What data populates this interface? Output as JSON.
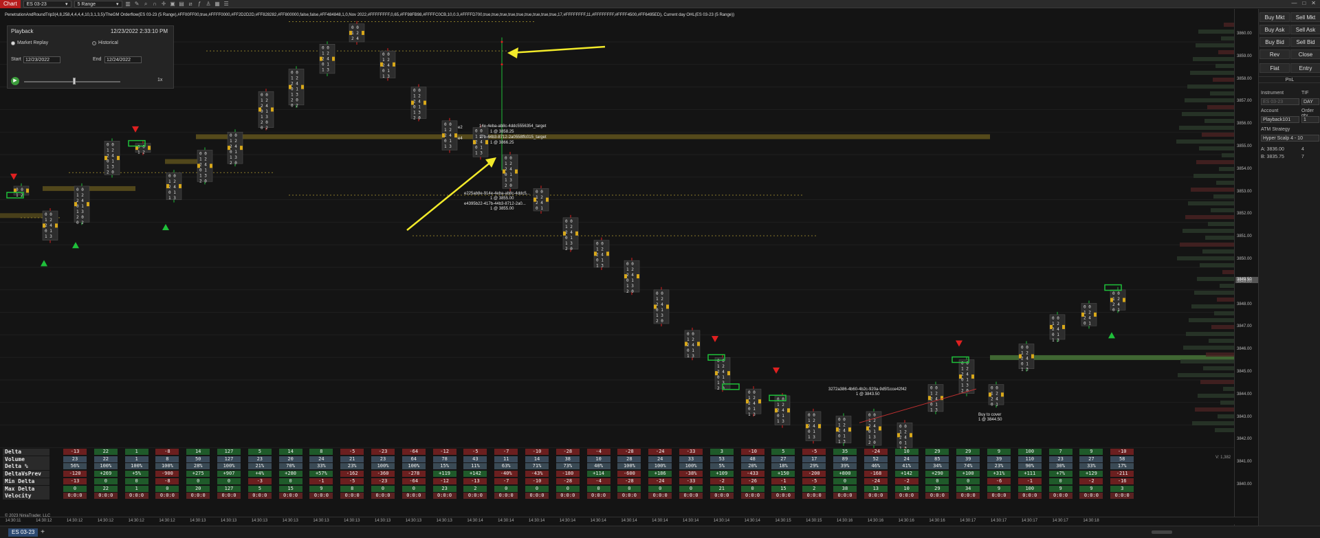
{
  "toolbar": {
    "chart_tag": "Chart",
    "instrument": "ES 03-23",
    "bar_type": "5 Range"
  },
  "indicator_label": "PenetrationAndRoundTrip3(4,8,258,4,4,4,4,10,3,1,3,5)/TheGM Orderflow(ES 03-23 (5 Range),#FF00FF00,true,#FFFF0000,#FF2D2D2D,#FF828282,#FF800000,false,false,#FF484848,1,0,Nov 2022,#FFFFFFFF,0,65,#FF98FB98,#FFFFC0CB,10,0.3,#FFFFD700,true,true,true,true,true,true,true,true,true,17,#FFFFFFFF,11,#FFFFFFFF,#FFFF4500,#FF6495ED), Current day OHL(ES 03-23 (5 Range))",
  "playback": {
    "title": "Playback",
    "datetime": "12/23/2022 2:33:10 PM",
    "market_replay": "Market Replay",
    "historical": "Historical",
    "start_label": "Start",
    "start_value": "12/23/2022",
    "end_label": "End",
    "end_value": "12/24/2022",
    "speed": "1x"
  },
  "price_axis": {
    "labels": [
      "3860.00",
      "3859.00",
      "3858.00",
      "3857.00",
      "3856.00",
      "3855.00",
      "3854.00",
      "3853.00",
      "3852.00",
      "3851.00",
      "3850.00",
      "3849.00",
      "3848.00",
      "3847.00",
      "3846.00",
      "3845.00",
      "3844.00",
      "3843.00",
      "3842.00",
      "3841.00",
      "3840.00"
    ],
    "current": "3849.50"
  },
  "annotations": {
    "target1": "14e-4eba-ab8c-4ddc5556354_target",
    "target1_price": "1 @ 3858.25",
    "target2": "17b-44b3-8712-2a0558ffc015_target",
    "target2_price": "1 @ 3866.25",
    "stop1": "e225ab8e-914e-4eba-ab8c-4ddc5...",
    "stop1_price": "1 @ 3855.00",
    "stop2": "e4395b22-417b-44b3-8712-2a0...",
    "stop2_price": "1 @ 3855.00",
    "order3": "3272a386-4b60-4b2c-920a-9d5f1cce42f42",
    "order3_price": "1 @ 3843.50",
    "buy_cover": "Buy to cover",
    "buy_cover_price": "1 @ 3844.50",
    "small_a": "e2",
    "small_b": "e4"
  },
  "stats": {
    "row_names": [
      "Delta",
      "Volume",
      "Delta %",
      "DeltaVsPrev",
      "Min Delta",
      "Max Delta",
      "Velocity"
    ],
    "columns": [
      [
        "-13",
        "23",
        "56%",
        "-120",
        "-13",
        "0",
        "0:0:0"
      ],
      [
        "22",
        "22",
        "100%",
        "+269",
        "0",
        "22",
        "0:0:0"
      ],
      [
        "1",
        "1",
        "100%",
        "+5%",
        "0",
        "1",
        "0:0:0"
      ],
      [
        "-8",
        "8",
        "100%",
        "-900",
        "-8",
        "0",
        "0:0:0"
      ],
      [
        "14",
        "50",
        "28%",
        "+275",
        "0",
        "20",
        "0:0:0"
      ],
      [
        "127",
        "127",
        "100%",
        "+907",
        "0",
        "127",
        "0:0:0"
      ],
      [
        "5",
        "23",
        "21%",
        "+4%",
        "-3",
        "5",
        "0:0:0"
      ],
      [
        "14",
        "20",
        "70%",
        "+280",
        "0",
        "15",
        "0:0:0"
      ],
      [
        "8",
        "24",
        "33%",
        "+57%",
        "-1",
        "9",
        "0:0:0"
      ],
      [
        "-5",
        "21",
        "23%",
        "-162",
        "-5",
        "8",
        "0:0:0"
      ],
      [
        "-23",
        "23",
        "100%",
        "-360",
        "-23",
        "0",
        "0:0:0"
      ],
      [
        "-64",
        "64",
        "100%",
        "-278",
        "-64",
        "0",
        "0:0:0"
      ],
      [
        "-12",
        "78",
        "15%",
        "+119",
        "-12",
        "23",
        "0:0:0"
      ],
      [
        "-5",
        "43",
        "11%",
        "+142",
        "-13",
        "2",
        "0:0:0"
      ],
      [
        "-7",
        "11",
        "63%",
        "-40%",
        "-7",
        "0",
        "0:0:0"
      ],
      [
        "-10",
        "14",
        "71%",
        "-43%",
        "-10",
        "0",
        "0:0:0"
      ],
      [
        "-28",
        "38",
        "73%",
        "-180",
        "-28",
        "0",
        "0:0:0"
      ],
      [
        "-4",
        "10",
        "40%",
        "+114",
        "-4",
        "0",
        "0:0:0"
      ],
      [
        "-28",
        "28",
        "100%",
        "-600",
        "-28",
        "0",
        "0:0:0"
      ],
      [
        "-24",
        "24",
        "100%",
        "+186",
        "-24",
        "0",
        "0:0:0"
      ],
      [
        "-33",
        "33",
        "100%",
        "-38%",
        "-33",
        "0",
        "0:0:0"
      ],
      [
        "3",
        "53",
        "5%",
        "+109",
        "-2",
        "21",
        "0:0:0"
      ],
      [
        "-10",
        "48",
        "20%",
        "-433",
        "-26",
        "0",
        "0:0:0"
      ],
      [
        "5",
        "27",
        "18%",
        "+150",
        "-1",
        "15",
        "0:0:0"
      ],
      [
        "-5",
        "17",
        "29%",
        "-200",
        "-5",
        "2",
        "0:0:0"
      ],
      [
        "35",
        "89",
        "39%",
        "+800",
        "0",
        "38",
        "0:0:0"
      ],
      [
        "-24",
        "52",
        "46%",
        "-168",
        "-24",
        "13",
        "0:0:0"
      ],
      [
        "10",
        "24",
        "41%",
        "+142",
        "-2",
        "10",
        "0:0:0"
      ],
      [
        "29",
        "85",
        "34%",
        "+290",
        "0",
        "29",
        "0:0:0"
      ],
      [
        "29",
        "39",
        "74%",
        "+100",
        "0",
        "34",
        "0:0:0"
      ],
      [
        "9",
        "39",
        "23%",
        "+31%",
        "-6",
        "9",
        "0:0:0"
      ],
      [
        "100",
        "110",
        "90%",
        "+111",
        "-1",
        "100",
        "0:0:0"
      ],
      [
        "7",
        "23",
        "30%",
        "+7%",
        "0",
        "9",
        "0:0:0"
      ],
      [
        "9",
        "27",
        "33%",
        "+129",
        "-2",
        "9",
        "0:0:0"
      ],
      [
        "-10",
        "58",
        "17%",
        "-211",
        "-16",
        "3",
        "0:0:0"
      ]
    ]
  },
  "time_axis": [
    "14:30:11",
    "14:30:12",
    "14:30:12",
    "14:30:12",
    "14:30:12",
    "14:30:12",
    "14:30:13",
    "14:30:13",
    "14:30:13",
    "14:30:13",
    "14:30:13",
    "14:30:13",
    "14:30:13",
    "14:30:13",
    "14:30:13",
    "14:30:14",
    "14:30:14",
    "14:30:14",
    "14:30:14",
    "14:30:14",
    "14:30:14",
    "14:30:14",
    "14:30:14",
    "14:30:14",
    "14:30:14",
    "14:30:15",
    "14:30:15",
    "14:30:16",
    "14:30:16",
    "14:30:16",
    "14:30:16",
    "14:30:17",
    "14:30:17",
    "14:30:17",
    "14:30:17",
    "14:30:18"
  ],
  "copyright": "© 2023 NinjaTrader, LLC",
  "bottom": {
    "tab": "ES 03-23",
    "add": "+"
  },
  "trader": {
    "buy_mkt": "Buy Mkt",
    "sell_mkt": "Sell Mkt",
    "buy_ask": "Buy Ask",
    "sell_ask": "Sell Ask",
    "buy_bid": "Buy Bid",
    "sell_bid": "Sell Bid",
    "rev": "Rev",
    "close": "Close",
    "flat": "Flat",
    "entry": "Entry",
    "pnl": "PnL",
    "instrument_label": "Instrument",
    "tif_label": "TIF",
    "instrument_value": "ES 03-23",
    "tif_value": "DAY",
    "account_label": "Account",
    "order_qty_label": "Order qty",
    "account_value": "Playback101",
    "qty_value": "1",
    "atm_label": "ATM Strategy",
    "atm_value": "Hyper Scalp 4 - 10",
    "ask_label": "A: 3836.00",
    "ask_size": "4",
    "bid_label": "B: 3835.75",
    "bid_size": "7"
  },
  "volume_label": "V: 1,382",
  "colors": {
    "up": "#1fbf3a",
    "down": "#e02020",
    "zone": "#6b5c1e",
    "arrow": "#f2ea2a",
    "green_zone": "#4a7a3a"
  }
}
